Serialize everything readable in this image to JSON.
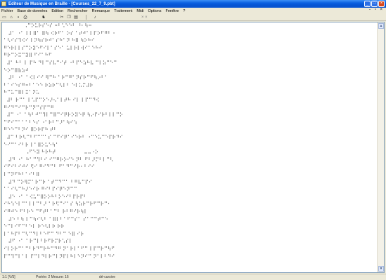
{
  "window": {
    "title": "Editeur de Musique en Braille - [Courses_22_7_9.pbt]",
    "title_icon": "app-icon",
    "controls": [
      "minimize-icon",
      "maximize-icon",
      "close-icon"
    ]
  },
  "menubar": {
    "items": [
      "Fichier",
      "Base de données",
      "Edition",
      "Rechercher",
      "Remarque",
      "Traitement",
      "Midi",
      "Options",
      "Fenêtre",
      "?"
    ],
    "window_controls_text": "- ▫ ×"
  },
  "toolbar": {
    "icons": [
      "new-icon",
      "open-icon",
      "save-icon",
      "print-icon",
      "find-icon",
      "cut-icon",
      "copy-icon",
      "paste-icon",
      "play-icon"
    ],
    "right_glyphs": "× ×"
  },
  "document": {
    "lines": [
      "             ⠠⠉⠕⠥⠗⠎⠑⠎ ⠒⠃⠡⠑⠑⠃ ⠘⠂⠳⠒",
      "   ⠼⠁ ⠐⠁ ⠇⠇⠿⠁ ⠿⠳ ⠪⠗⠋⠁ ⠕⠎ ⠁⠞⠚⠁⠇⠏⠕⠋⠛⠃ ⠂",
      "⠁⠣⠊⠎⠹⠪⠊ ⠇⠝⠳⠎⠗⠚⠁⠎⠓⠁⠝ ⠓⠿ ⠳⠕⠓⠊",
      "⠛⠑⠗⠇⠇⠎⠉⠕⠽⠑⠋⠊⠇⠁⠎⠑⠁ ⠥⠇⠗⠇⠺⠊⠁⠑⠓⠊",
      "⠛⠗⠉⠕⠭⠉⠽⠿ ⠋⠊⠁⠓⠋",
      "  ⠼⠁ ⠓⠃ ⠇ ⠏⠓ ⠙⠇⠉⠎⠧⠉⠊⠞ ⠐⠃⠏⠑⠵⠓⠧ ⠉⠇⠵⠉⠑⠉",
      "⠑⠕⠉⠿⠷⠵⠚",
      "   ⠼⠃ ⠐⠁ ⠁⠪⠇⠊⠊ ⠻⠉⠓ ⠁⠗⠉⠛⠁⠝⠎⠗⠉⠋⠳⠔⠃⠁",
      "⠃⠁⠊⠑⠎⠛⠒⠃⠁⠑⠑ ⠗⠵⠗⠉⠣⠇⠃ ⠑⠇⠥⠍⠼⠗",
      "⠓⠉⠥⠉⠿⠇⠭⠁⠝⠥",
      "  ⠼⠃ ⠗⠉⠁ ⠇⠡⠏⠉⠕⠑⠜⠢⠁⠇⠞⠓ ⠊⠇ ⠇⠏⠉⠙⠪",
      "⠛⠊⠙⠉⠊⠉⠗⠉⠝⠉⠎⠏⠉⠛",
      "  ⠼⠉ ⠐⠁ ⠁⠳⠃⠚⠉⠹⠇⠉⠿⠉⠊⠟⠗⠕⠽⠑⠟ ⠳⠔⠏⠊⠗⠃⠇⠇⠉⠕",
      "⠉⠋⠊⠉⠁⠁⠁⠃⠑⠎ ⠐⠁⠗⠃⠉⠜⠁⠳⠊⠱",
      "⠛⠑⠑⠉⠃⠝⠊ ⠿⠕⠗⠏⠓ ⠞⠃",
      "  ⠼⠉ ⠃⠗⠣⠉⠃⠋⠉⠉⠁⠎ ⠉⠋⠊⠟⠁⠊⠑⠗⠃ ⠐⠉⠑⠥⠉⠑⠏⠗⠙⠊",
      "⠑⠊⠉⠁⠊⠃⠗ ⠇⠁⠿⠕⠥⠑⠳⠁",
      "              ⠠⠋⠑⠽ ⠓⠗⠓⠞                  ⠤⠤⠐⠕",
      "   ⠼⠙ ⠐⠁ ⠓⠁⠉⠹⠃⠊ ⠊⠉⠛⠗⠕⠊⠑ ⠝⠃ ⠋⠃⠜⠍⠃⠇⠉⠣",
      "⠊⠋⠊⠃⠊⠚⠊ ⠫⠊ ⠛⠊⠙⠉⠃ ⠋⠁⠙⠉⠊⠗⠂⠃⠊⠊",
      "⠇⠉⠝⠋⠓⠃⠁⠊⠃⠿",
      "   ⠼⠙ ⠉⠕⠻⠍⠁⠗⠉⠗ ⠁⠞⠉⠙⠉⠁ ⠃⠛⠧⠉⠏⠊",
      "⠁⠁⠊⠣⠉⠓⠜⠑⠊⠗ ⠛⠊⠃⠏⠊⠟⠑⠝⠉⠉",
      "   ⠼⠑ ⠐⠁ ⠁⠪⠥⠉⠿⠕⠕⠓⠃⠕⠑⠊⠃⠏⠗⠏⠃",
      "⠊⠓⠱⠑⠇⠉⠁⠇⠇⠉⠃⠜ ⠁⠗⠫⠉⠊⠁⠎ ⠳⠵⠗⠉⠗⠋⠉⠗⠉⠂",
      "⠊⠛⠚⠑ ⠋⠃⠗⠑ ⠉⠋⠞⠃⠁⠉⠃ ⠗⠃⠛⠊⠗⠳⠇",
      "   ⠼⠑ ⠃⠳ ⠇⠉⠳⠊⠣⠃ ⠁⠿⠇⠃⠁⠋⠉⠎⠁ ⠎⠁⠉⠉⠞⠉⠑",
      "⠑⠉⠇⠊⠋⠉⠃⠑⠇ ⠗⠑⠣⠇⠗ ⠗⠗",
      "⠇⠁⠓⠏⠃⠉⠣⠉⠙⠇⠃⠑⠋⠉ ⠙⠃⠉ ⠑⠿ ⠊⠗",
      "   ⠼⠋ ⠐⠁ ⠁⠗⠉⠇⠃⠗⠋⠗⠍⠗⠡⠎⠇",
      "⠊⠇⠕⠗⠉⠁⠉⠃⠗⠙⠉⠗⠓⠉⠙⠛ ⠝⠁⠗⠇⠁⠋⠉ ⠇⠏⠉⠗⠉⠳⠋",
      "⠏⠉⠹⠉⠇⠁⠇ ⠏⠉⠇⠙⠇⠗⠉⠇⠝⠏⠇⠓⠇⠑⠝⠊⠉ ⠝⠁⠇⠃⠙⠊"
    ]
  },
  "statusbar": {
    "position": "1:1 [V/5]",
    "parts": "Portée: 2  Mesure: 16",
    "mode": "dé-cursive"
  }
}
